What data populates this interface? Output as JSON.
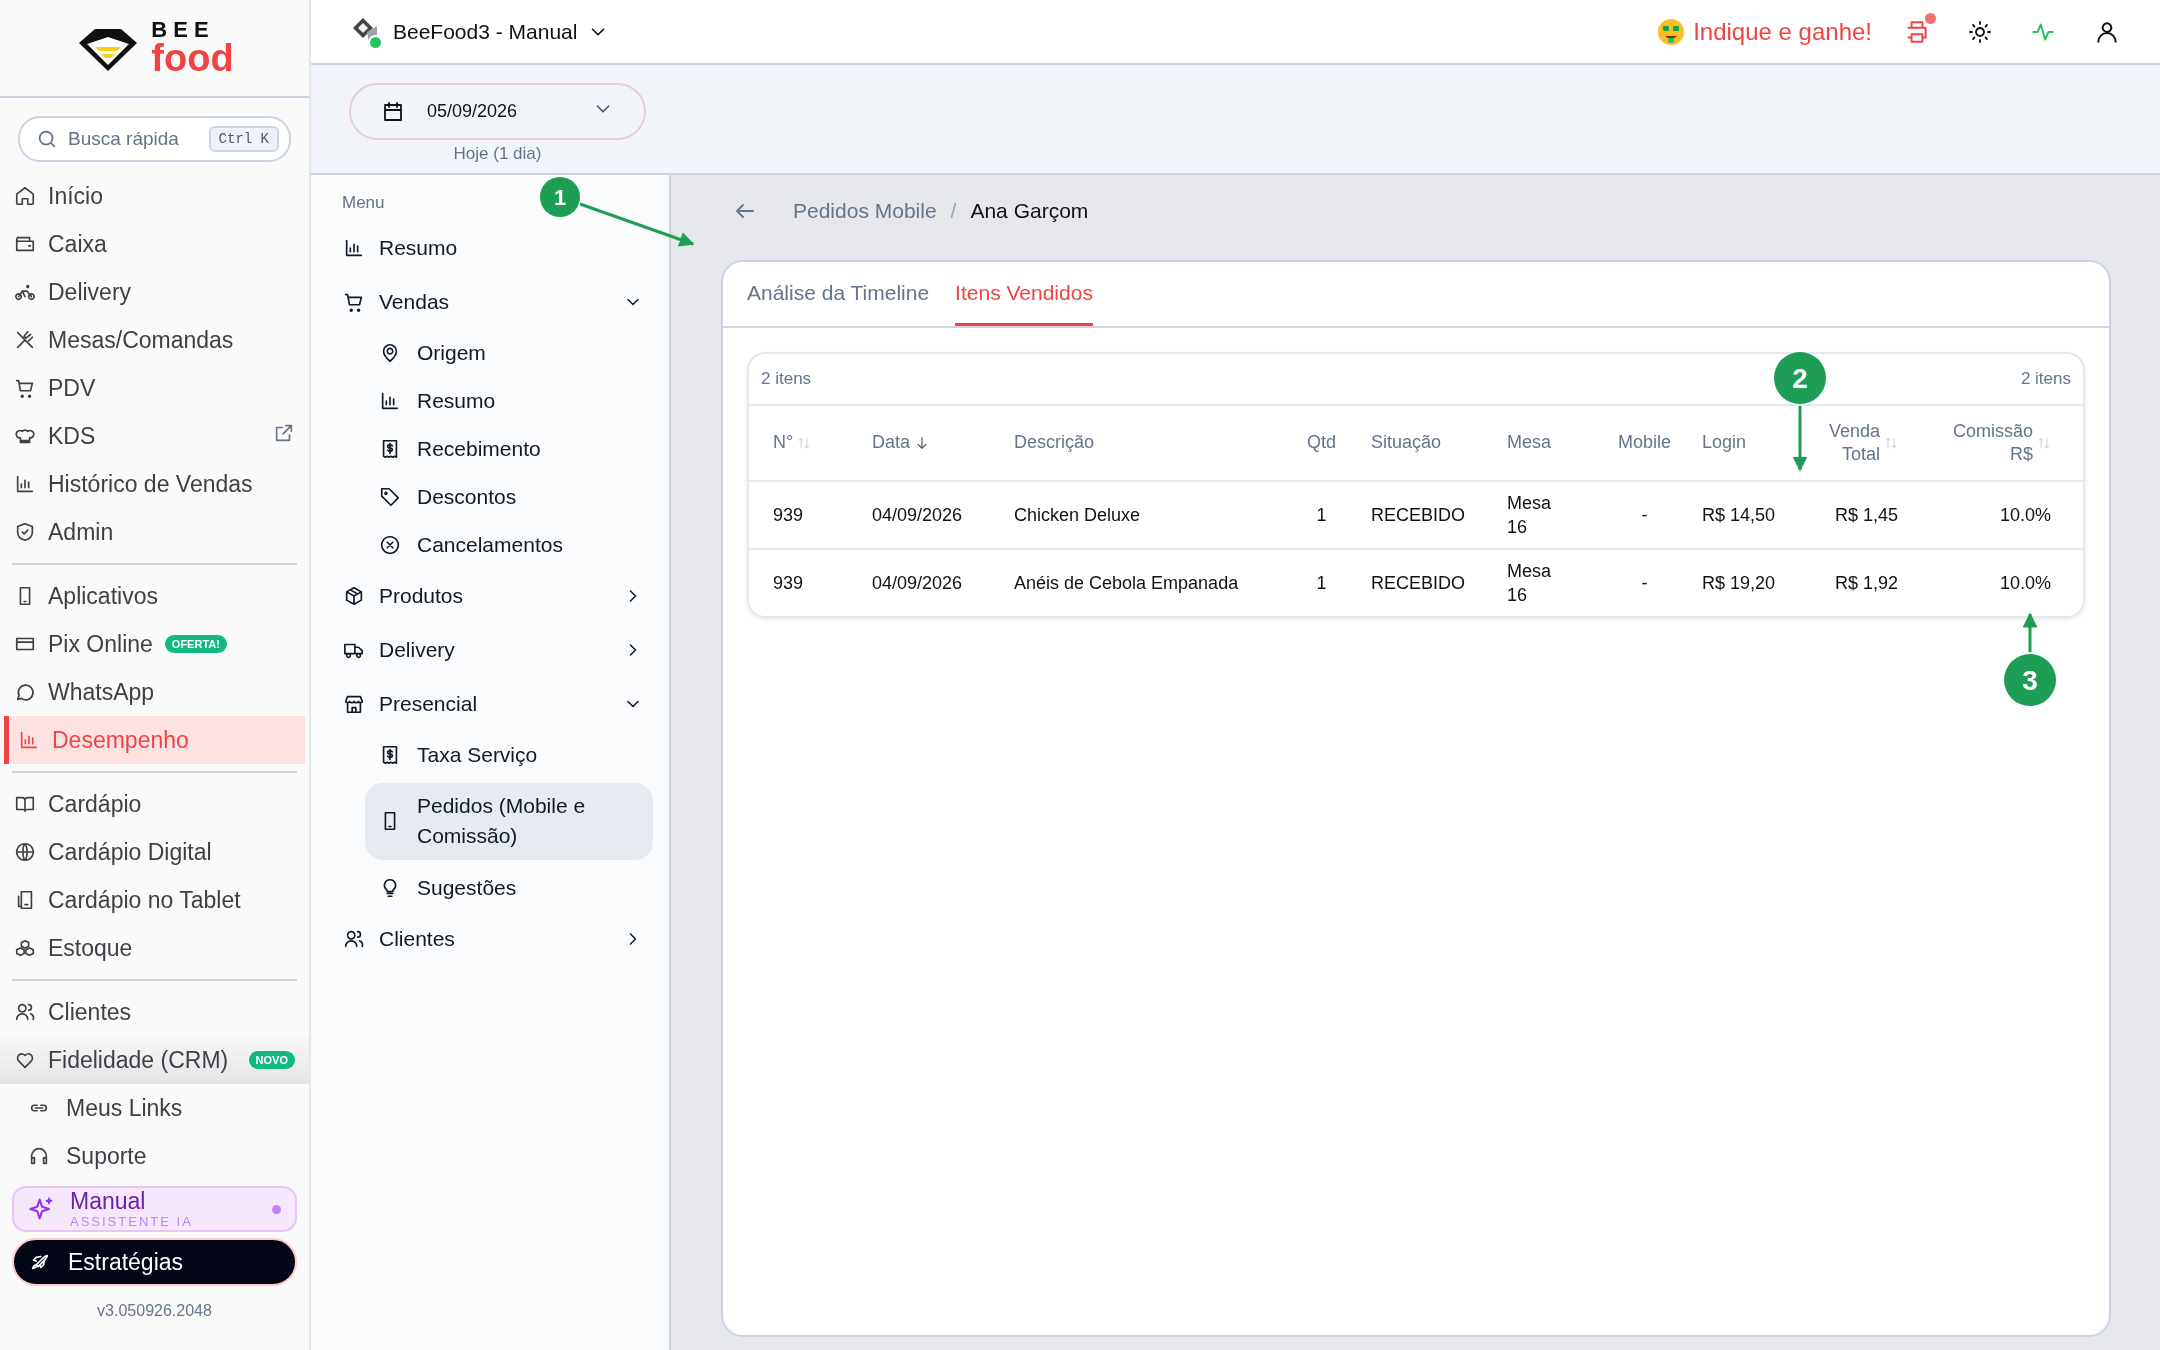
{
  "sidebar": {
    "logo": {
      "top": "BEE",
      "bottom": "food"
    },
    "search": {
      "placeholder": "Busca rápida",
      "shortcut": "Ctrl K"
    },
    "sections": [
      {
        "items": [
          {
            "label": "Início",
            "selected": false
          },
          {
            "label": "Caixa",
            "selected": false
          },
          {
            "label": "Delivery",
            "selected": false
          },
          {
            "label": "Mesas/Comandas",
            "selected": false
          },
          {
            "label": "PDV",
            "selected": false
          },
          {
            "label": "KDS",
            "selected": false,
            "external": true
          },
          {
            "label": "Histórico de Vendas",
            "selected": false
          },
          {
            "label": "Admin",
            "selected": false
          }
        ]
      },
      {
        "items": [
          {
            "label": "Aplicativos",
            "selected": false
          },
          {
            "label": "Pix Online",
            "selected": false,
            "badge": "OFERTA!"
          },
          {
            "label": "WhatsApp",
            "selected": false
          },
          {
            "label": "Desempenho",
            "selected": true
          }
        ]
      },
      {
        "items": [
          {
            "label": "Cardápio",
            "selected": false
          },
          {
            "label": "Cardápio Digital",
            "selected": false
          },
          {
            "label": "Cardápio no Tablet",
            "selected": false
          },
          {
            "label": "Estoque",
            "selected": false
          }
        ]
      },
      {
        "items": [
          {
            "label": "Clientes",
            "selected": false
          },
          {
            "label": "Fidelidade (CRM)",
            "selected": false,
            "hovered": true,
            "badge": "NOVO"
          }
        ]
      }
    ],
    "links": [
      {
        "label": "Meus Links",
        "selected": false
      },
      {
        "label": "Suporte",
        "selected": false
      }
    ],
    "assistant": {
      "title": "Manual",
      "subtitle": "ASSISTENTE IA"
    },
    "strategies": {
      "label": "Estratégias"
    },
    "version": "v3.050926.2048"
  },
  "topbar": {
    "store": "BeeFood3 - Manual",
    "online": true,
    "referral": "Indique e ganhe!",
    "printer_alert": true
  },
  "date_filter": {
    "value": "05/09/2026",
    "caption": "Hoje (1 dia)"
  },
  "menu": {
    "title": "Menu",
    "items": [
      {
        "label": "Resumo",
        "selected": false
      },
      {
        "label": "Vendas",
        "selected": false,
        "expanded": true,
        "children": [
          {
            "label": "Origem",
            "selected": false
          },
          {
            "label": "Resumo",
            "selected": false
          },
          {
            "label": "Recebimento",
            "selected": false
          },
          {
            "label": "Descontos",
            "selected": false
          },
          {
            "label": "Cancelamentos",
            "selected": false
          }
        ]
      },
      {
        "label": "Produtos",
        "selected": false,
        "expanded": false
      },
      {
        "label": "Delivery",
        "selected": false,
        "expanded": false
      },
      {
        "label": "Presencial",
        "selected": false,
        "expanded": true,
        "children": [
          {
            "label": "Taxa Serviço",
            "selected": false
          },
          {
            "label": "Pedidos (Mobile e Comissão)",
            "selected": true
          },
          {
            "label": "Sugestões",
            "selected": false
          }
        ]
      },
      {
        "label": "Clientes",
        "selected": false,
        "expanded": false
      }
    ]
  },
  "breadcrumb": {
    "parent": "Pedidos Mobile",
    "separator": "/",
    "current": "Ana Garçom"
  },
  "tabs": [
    {
      "label": "Análise da Timeline",
      "selected": false
    },
    {
      "label": "Itens Vendidos",
      "selected": true
    }
  ],
  "table": {
    "count_left": "2 itens",
    "count_right": "2 itens",
    "columns": [
      {
        "label": "N°",
        "sortable": true,
        "sorted": false
      },
      {
        "label": "Data",
        "sortable": false,
        "sorted": true
      },
      {
        "label": "Descrição",
        "sortable": false,
        "sorted": false
      },
      {
        "label": "Qtd",
        "sortable": false,
        "sorted": false
      },
      {
        "label": "Situação",
        "sortable": false,
        "sorted": false
      },
      {
        "label": "Mesa",
        "sortable": false,
        "sorted": false
      },
      {
        "label": "Mobile",
        "sortable": false,
        "sorted": false
      },
      {
        "label": "Login",
        "sortable": false,
        "sorted": false
      },
      {
        "label": "Venda Total",
        "sortable": true,
        "sorted": false
      },
      {
        "label": "Comissão R$",
        "sortable": true,
        "sorted": false
      }
    ],
    "rows": [
      [
        "939",
        "04/09/2026",
        "Chicken Deluxe",
        "1",
        "RECEBIDO",
        "Mesa 16",
        "-",
        "R$ 14,50",
        "R$ 1,45",
        "10.0%"
      ],
      [
        "939",
        "04/09/2026",
        "Anéis de Cebola Empanada",
        "1",
        "RECEBIDO",
        "Mesa 16",
        "-",
        "R$ 19,20",
        "R$ 1,92",
        "10.0%"
      ]
    ]
  },
  "annotations": [
    {
      "label": "1"
    },
    {
      "label": "2"
    },
    {
      "label": "3"
    }
  ]
}
